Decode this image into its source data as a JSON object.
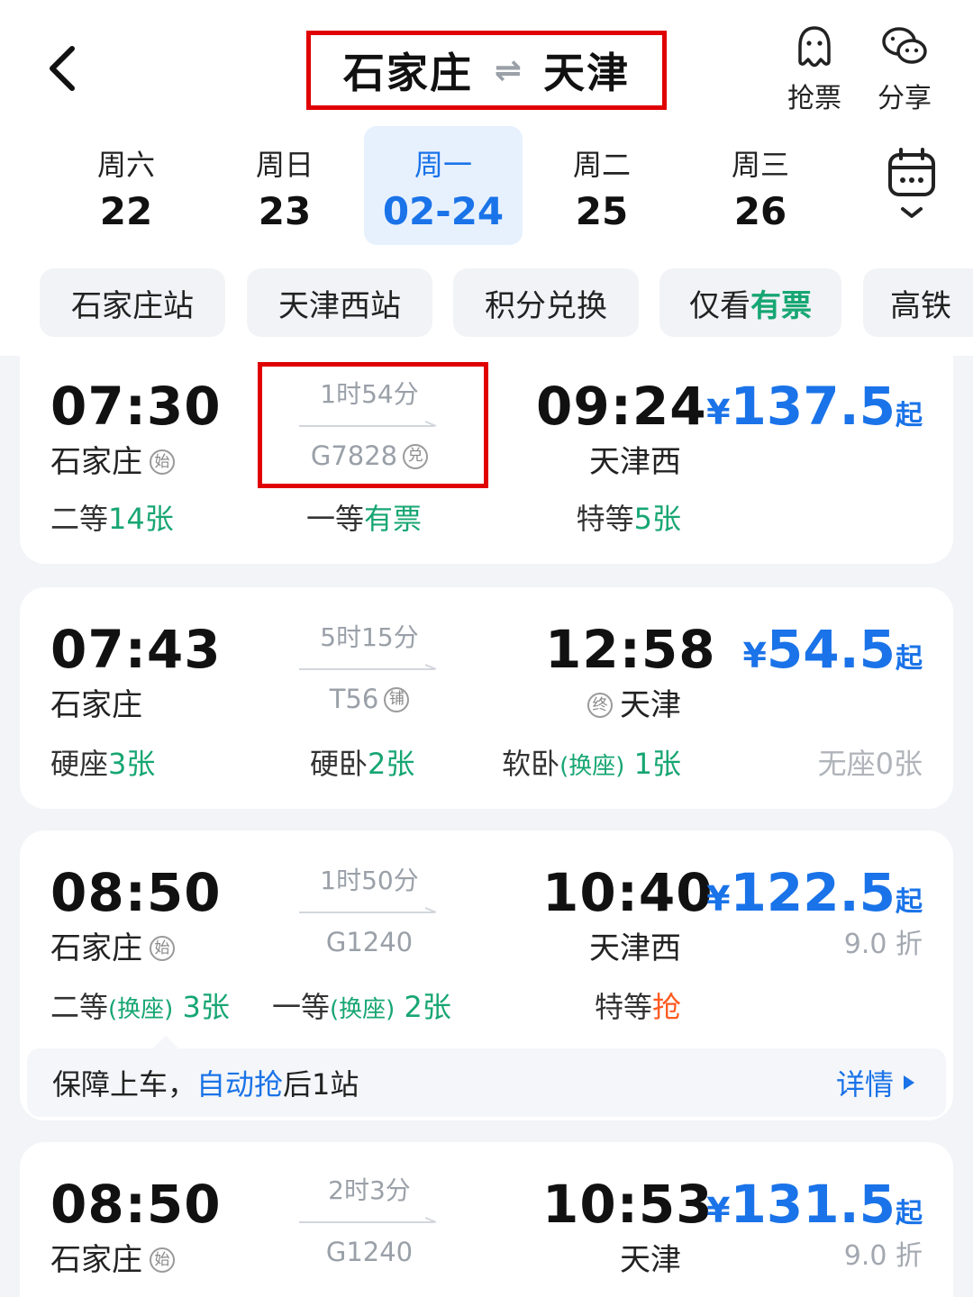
{
  "header": {
    "origin": "石家庄",
    "swap_symbol": "⇌",
    "destination": "天津",
    "actions": [
      {
        "label": "抢票",
        "icon": "ghost-icon"
      },
      {
        "label": "分享",
        "icon": "wechat-icon"
      }
    ]
  },
  "dates": [
    {
      "weekday": "周六",
      "date": "22"
    },
    {
      "weekday": "周日",
      "date": "23"
    },
    {
      "weekday": "周一",
      "date": "02-24",
      "active": true
    },
    {
      "weekday": "周二",
      "date": "25"
    },
    {
      "weekday": "周三",
      "date": "26"
    }
  ],
  "filters": {
    "c0": "石家庄站",
    "c1": "天津西站",
    "c2": "积分兑换",
    "c3_prefix": "仅看",
    "c3_green": "有票",
    "c4": "高铁"
  },
  "trains": [
    {
      "depart": "07:30",
      "from": "石家庄",
      "from_tag": "始",
      "duration": "1时54分",
      "train_no": "G7828",
      "train_tag": "兑",
      "arrive": "09:24",
      "to": "天津西",
      "price_symbol": "¥",
      "price": "137.5",
      "price_suffix": "起",
      "seats": {
        "a_label": "二等",
        "a_val": "14",
        "a_unit": "张",
        "b_label": "一等",
        "b_val": "有票",
        "c_label": "特等",
        "c_val": "5",
        "c_unit": "张"
      }
    },
    {
      "depart": "07:43",
      "from": "石家庄",
      "duration": "5时15分",
      "train_no": "T56",
      "train_tag": "铺",
      "arrive": "12:58",
      "to": "天津",
      "to_tag": "终",
      "price_symbol": "¥",
      "price": "54.5",
      "price_suffix": "起",
      "seats": {
        "a_label": "硬座",
        "a_val": "3",
        "a_unit": "张",
        "b_label": "硬卧",
        "b_val": "2",
        "b_unit": "张",
        "c_label": "软卧",
        "c_note": "(换座)",
        "c_val": "1",
        "c_unit": "张",
        "d_label": "无座",
        "d_val": "0",
        "d_unit": "张"
      }
    },
    {
      "depart": "08:50",
      "from": "石家庄",
      "from_tag": "始",
      "duration": "1时50分",
      "train_no": "G1240",
      "arrive": "10:40",
      "to": "天津西",
      "price_symbol": "¥",
      "price": "122.5",
      "price_suffix": "起",
      "discount": "9.0 折",
      "seats": {
        "a_label": "二等",
        "a_note": "(换座)",
        "a_val": "3",
        "a_unit": "张",
        "b_label": "一等",
        "b_note": "(换座)",
        "b_val": "2",
        "b_unit": "张",
        "c_label": "特等",
        "c_val": "抢"
      },
      "guarantee": {
        "prefix": "保障上车，",
        "link": "自动抢",
        "suffix": "后1站",
        "detail": "详情"
      }
    },
    {
      "depart": "08:50",
      "from": "石家庄",
      "from_tag": "始",
      "duration": "2时3分",
      "train_no": "G1240",
      "arrive": "10:53",
      "to": "天津",
      "price_symbol": "¥",
      "price": "131.5",
      "price_suffix": "起",
      "discount": "9.0 折"
    }
  ],
  "colors": {
    "accent": "#1a73e8",
    "available": "#17a673",
    "grab": "#ff5a1f",
    "highlight_box": "#e00000"
  }
}
